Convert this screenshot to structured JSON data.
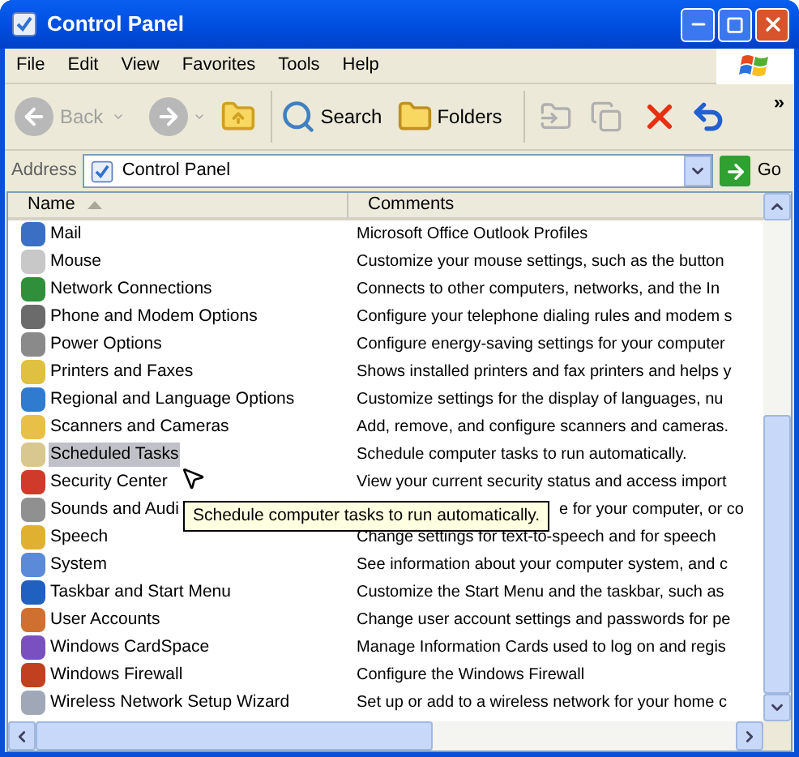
{
  "window": {
    "title": "Control Panel"
  },
  "menu": [
    "File",
    "Edit",
    "View",
    "Favorites",
    "Tools",
    "Help"
  ],
  "toolbar": {
    "back": {
      "label": "Back",
      "disabled": true
    },
    "search": "Search",
    "folders": "Folders",
    "more": "»"
  },
  "address": {
    "label": "Address",
    "value": "Control Panel",
    "go": "Go"
  },
  "columns": [
    {
      "label": "Name",
      "sorted": true
    },
    {
      "label": "Comments",
      "sorted": false
    }
  ],
  "items": [
    {
      "name": "Mail",
      "comment": "Microsoft Office Outlook Profiles",
      "color": "#3a6fc4",
      "selected": false
    },
    {
      "name": "Mouse",
      "comment": "Customize your mouse settings, such as the button",
      "color": "#c8c8c8",
      "selected": false
    },
    {
      "name": "Network Connections",
      "comment": "Connects to other computers, networks, and the In",
      "color": "#2f8f3a",
      "selected": false
    },
    {
      "name": "Phone and Modem Options",
      "comment": "Configure your telephone dialing rules and modem s",
      "color": "#6b6b6b",
      "selected": false
    },
    {
      "name": "Power Options",
      "comment": "Configure energy-saving settings for your computer",
      "color": "#8a8a8a",
      "selected": false
    },
    {
      "name": "Printers and Faxes",
      "comment": "Shows installed printers and fax printers and helps y",
      "color": "#e0c040",
      "selected": false
    },
    {
      "name": "Regional and Language Options",
      "comment": "Customize settings for the display of languages, nu",
      "color": "#2e7bcf",
      "selected": false
    },
    {
      "name": "Scanners and Cameras",
      "comment": "Add, remove, and configure scanners and cameras.",
      "color": "#e8c048",
      "selected": false
    },
    {
      "name": "Scheduled Tasks",
      "comment": "Schedule computer tasks to run automatically.",
      "color": "#d8c890",
      "selected": true
    },
    {
      "name": "Security Center",
      "comment": "View your current security status and access import",
      "color": "#d03a2a",
      "selected": false
    },
    {
      "name": "Sounds and Audi",
      "comment": "e for your computer, or co",
      "color": "#909090",
      "selected": false,
      "covered": true
    },
    {
      "name": "Speech",
      "comment": "Change settings for text-to-speech and for speech",
      "color": "#e0b030",
      "selected": false
    },
    {
      "name": "System",
      "comment": "See information about your computer system, and c",
      "color": "#5a8ad8",
      "selected": false
    },
    {
      "name": "Taskbar and Start Menu",
      "comment": "Customize the Start Menu and the taskbar, such as",
      "color": "#2060c0",
      "selected": false
    },
    {
      "name": "User Accounts",
      "comment": "Change user account settings and passwords for pe",
      "color": "#d07030",
      "selected": false
    },
    {
      "name": "Windows CardSpace",
      "comment": "Manage Information Cards used to log on and regis",
      "color": "#7a50c0",
      "selected": false
    },
    {
      "name": "Windows Firewall",
      "comment": "Configure the Windows Firewall",
      "color": "#c04020",
      "selected": false
    },
    {
      "name": "Wireless Network Setup Wizard",
      "comment": "Set up or add to a wireless network for your home c",
      "color": "#a0a8b8",
      "selected": false
    }
  ],
  "tooltip": {
    "text": "Schedule computer tasks to run automatically.",
    "visible": true
  }
}
